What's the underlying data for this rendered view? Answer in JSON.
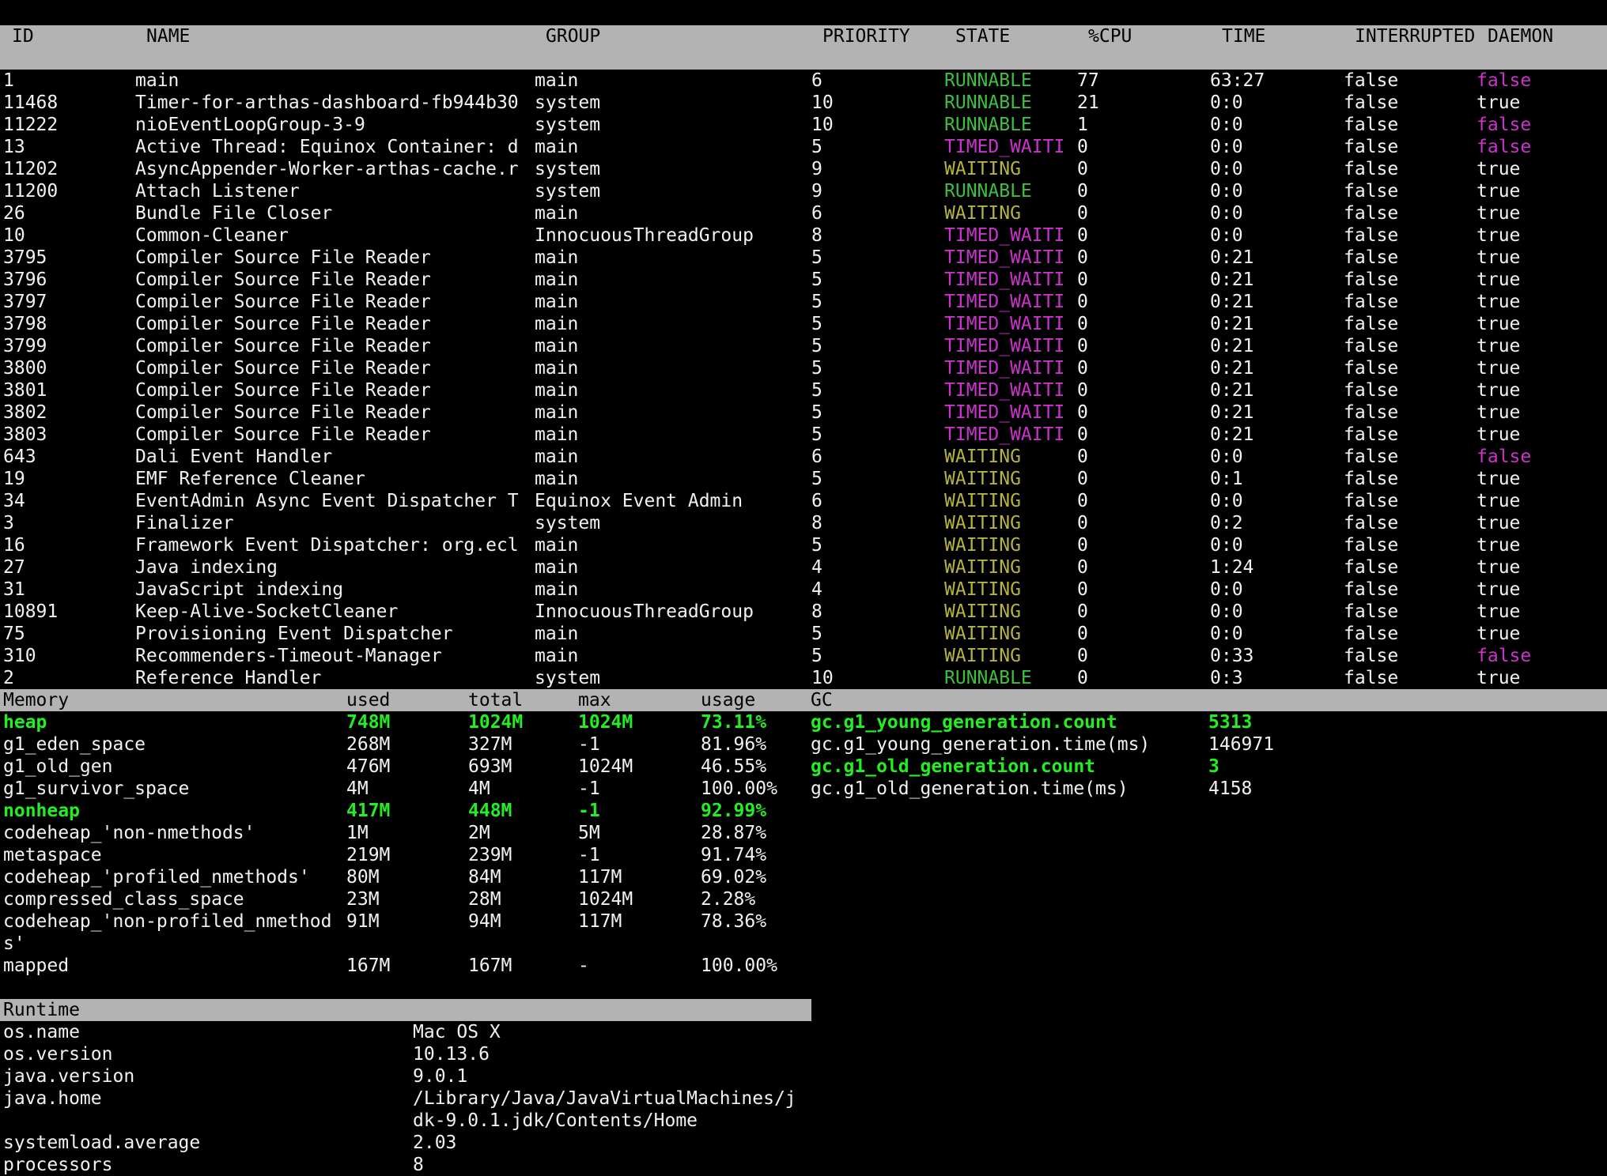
{
  "colors": {
    "background": "#000000",
    "header_bg": "#b3b3b3",
    "text": "#f2f2f2",
    "runnable": "#3fbf3f",
    "waiting": "#b7b33f",
    "timed_waiting": "#cc33cc",
    "highlight": "#22ee22"
  },
  "threads": {
    "columns": [
      "ID",
      "NAME",
      "GROUP",
      "PRIORITY",
      "STATE",
      "%CPU",
      "TIME",
      "INTERRUPTED",
      "DAEMON"
    ],
    "rows": [
      {
        "id": "1",
        "name": "main",
        "group": "main",
        "priority": "6",
        "state": "RUNNABLE",
        "cpu": "77",
        "time": "63:27",
        "interrupted": "false",
        "daemon": "false"
      },
      {
        "id": "11468",
        "name": "Timer-for-arthas-dashboard-fb944b30",
        "group": "system",
        "priority": "10",
        "state": "RUNNABLE",
        "cpu": "21",
        "time": "0:0",
        "interrupted": "false",
        "daemon": "true"
      },
      {
        "id": "11222",
        "name": "nioEventLoopGroup-3-9",
        "group": "system",
        "priority": "10",
        "state": "RUNNABLE",
        "cpu": "1",
        "time": "0:0",
        "interrupted": "false",
        "daemon": "false"
      },
      {
        "id": "13",
        "name": "Active Thread: Equinox Container: d",
        "group": "main",
        "priority": "5",
        "state": "TIMED_WAITI",
        "cpu": "0",
        "time": "0:0",
        "interrupted": "false",
        "daemon": "false"
      },
      {
        "id": "11202",
        "name": "AsyncAppender-Worker-arthas-cache.r",
        "group": "system",
        "priority": "9",
        "state": "WAITING",
        "cpu": "0",
        "time": "0:0",
        "interrupted": "false",
        "daemon": "true"
      },
      {
        "id": "11200",
        "name": "Attach Listener",
        "group": "system",
        "priority": "9",
        "state": "RUNNABLE",
        "cpu": "0",
        "time": "0:0",
        "interrupted": "false",
        "daemon": "true"
      },
      {
        "id": "26",
        "name": "Bundle File Closer",
        "group": "main",
        "priority": "6",
        "state": "WAITING",
        "cpu": "0",
        "time": "0:0",
        "interrupted": "false",
        "daemon": "true"
      },
      {
        "id": "10",
        "name": "Common-Cleaner",
        "group": "InnocuousThreadGroup",
        "priority": "8",
        "state": "TIMED_WAITI",
        "cpu": "0",
        "time": "0:0",
        "interrupted": "false",
        "daemon": "true"
      },
      {
        "id": "3795",
        "name": "Compiler Source File Reader",
        "group": "main",
        "priority": "5",
        "state": "TIMED_WAITI",
        "cpu": "0",
        "time": "0:21",
        "interrupted": "false",
        "daemon": "true"
      },
      {
        "id": "3796",
        "name": "Compiler Source File Reader",
        "group": "main",
        "priority": "5",
        "state": "TIMED_WAITI",
        "cpu": "0",
        "time": "0:21",
        "interrupted": "false",
        "daemon": "true"
      },
      {
        "id": "3797",
        "name": "Compiler Source File Reader",
        "group": "main",
        "priority": "5",
        "state": "TIMED_WAITI",
        "cpu": "0",
        "time": "0:21",
        "interrupted": "false",
        "daemon": "true"
      },
      {
        "id": "3798",
        "name": "Compiler Source File Reader",
        "group": "main",
        "priority": "5",
        "state": "TIMED_WAITI",
        "cpu": "0",
        "time": "0:21",
        "interrupted": "false",
        "daemon": "true"
      },
      {
        "id": "3799",
        "name": "Compiler Source File Reader",
        "group": "main",
        "priority": "5",
        "state": "TIMED_WAITI",
        "cpu": "0",
        "time": "0:21",
        "interrupted": "false",
        "daemon": "true"
      },
      {
        "id": "3800",
        "name": "Compiler Source File Reader",
        "group": "main",
        "priority": "5",
        "state": "TIMED_WAITI",
        "cpu": "0",
        "time": "0:21",
        "interrupted": "false",
        "daemon": "true"
      },
      {
        "id": "3801",
        "name": "Compiler Source File Reader",
        "group": "main",
        "priority": "5",
        "state": "TIMED_WAITI",
        "cpu": "0",
        "time": "0:21",
        "interrupted": "false",
        "daemon": "true"
      },
      {
        "id": "3802",
        "name": "Compiler Source File Reader",
        "group": "main",
        "priority": "5",
        "state": "TIMED_WAITI",
        "cpu": "0",
        "time": "0:21",
        "interrupted": "false",
        "daemon": "true"
      },
      {
        "id": "3803",
        "name": "Compiler Source File Reader",
        "group": "main",
        "priority": "5",
        "state": "TIMED_WAITI",
        "cpu": "0",
        "time": "0:21",
        "interrupted": "false",
        "daemon": "true"
      },
      {
        "id": "643",
        "name": "Dali Event Handler",
        "group": "main",
        "priority": "6",
        "state": "WAITING",
        "cpu": "0",
        "time": "0:0",
        "interrupted": "false",
        "daemon": "false"
      },
      {
        "id": "19",
        "name": "EMF Reference Cleaner",
        "group": "main",
        "priority": "5",
        "state": "WAITING",
        "cpu": "0",
        "time": "0:1",
        "interrupted": "false",
        "daemon": "true"
      },
      {
        "id": "34",
        "name": "EventAdmin Async Event Dispatcher T",
        "group": "Equinox Event Admin",
        "priority": "6",
        "state": "WAITING",
        "cpu": "0",
        "time": "0:0",
        "interrupted": "false",
        "daemon": "true"
      },
      {
        "id": "3",
        "name": "Finalizer",
        "group": "system",
        "priority": "8",
        "state": "WAITING",
        "cpu": "0",
        "time": "0:2",
        "interrupted": "false",
        "daemon": "true"
      },
      {
        "id": "16",
        "name": "Framework Event Dispatcher: org.ecl",
        "group": "main",
        "priority": "5",
        "state": "WAITING",
        "cpu": "0",
        "time": "0:0",
        "interrupted": "false",
        "daemon": "true"
      },
      {
        "id": "27",
        "name": "Java indexing",
        "group": "main",
        "priority": "4",
        "state": "WAITING",
        "cpu": "0",
        "time": "1:24",
        "interrupted": "false",
        "daemon": "true"
      },
      {
        "id": "31",
        "name": "JavaScript indexing",
        "group": "main",
        "priority": "4",
        "state": "WAITING",
        "cpu": "0",
        "time": "0:0",
        "interrupted": "false",
        "daemon": "true"
      },
      {
        "id": "10891",
        "name": "Keep-Alive-SocketCleaner",
        "group": "InnocuousThreadGroup",
        "priority": "8",
        "state": "WAITING",
        "cpu": "0",
        "time": "0:0",
        "interrupted": "false",
        "daemon": "true"
      },
      {
        "id": "75",
        "name": "Provisioning Event Dispatcher",
        "group": "main",
        "priority": "5",
        "state": "WAITING",
        "cpu": "0",
        "time": "0:0",
        "interrupted": "false",
        "daemon": "true"
      },
      {
        "id": "310",
        "name": "Recommenders-Timeout-Manager",
        "group": "main",
        "priority": "5",
        "state": "WAITING",
        "cpu": "0",
        "time": "0:33",
        "interrupted": "false",
        "daemon": "false"
      },
      {
        "id": "2",
        "name": "Reference Handler",
        "group": "system",
        "priority": "10",
        "state": "RUNNABLE",
        "cpu": "0",
        "time": "0:3",
        "interrupted": "false",
        "daemon": "true"
      }
    ]
  },
  "memory": {
    "columns": [
      "Memory",
      "used",
      "total",
      "max",
      "usage"
    ],
    "rows": [
      {
        "name": "heap",
        "used": "748M",
        "total": "1024M",
        "max": "1024M",
        "usage": "73.11%",
        "highlight": true
      },
      {
        "name": "g1_eden_space",
        "used": "268M",
        "total": "327M",
        "max": "-1",
        "usage": "81.96%"
      },
      {
        "name": "g1_old_gen",
        "used": "476M",
        "total": "693M",
        "max": "1024M",
        "usage": "46.55%"
      },
      {
        "name": "g1_survivor_space",
        "used": "4M",
        "total": "4M",
        "max": "-1",
        "usage": "100.00%"
      },
      {
        "name": "nonheap",
        "used": "417M",
        "total": "448M",
        "max": "-1",
        "usage": "92.99%",
        "highlight": true
      },
      {
        "name": "codeheap_'non-nmethods'",
        "used": "1M",
        "total": "2M",
        "max": "5M",
        "usage": "28.87%"
      },
      {
        "name": "metaspace",
        "used": "219M",
        "total": "239M",
        "max": "-1",
        "usage": "91.74%"
      },
      {
        "name": "codeheap_'profiled_nmethods'",
        "used": "80M",
        "total": "84M",
        "max": "117M",
        "usage": "69.02%"
      },
      {
        "name": "compressed_class_space",
        "used": "23M",
        "total": "28M",
        "max": "1024M",
        "usage": "2.28%"
      },
      {
        "name": "codeheap_'non-profiled_nmethod",
        "name_wrap": "s'",
        "used": "91M",
        "total": "94M",
        "max": "117M",
        "usage": "78.36%"
      },
      {
        "name": "mapped",
        "used": "167M",
        "total": "167M",
        "max": "-",
        "usage": "100.00%"
      }
    ]
  },
  "gc": {
    "header": "GC",
    "rows": [
      {
        "name": "gc.g1_young_generation.count",
        "value": "5313",
        "highlight": true
      },
      {
        "name": "gc.g1_young_generation.time(ms)",
        "value": "146971"
      },
      {
        "name": "gc.g1_old_generation.count",
        "value": "3",
        "highlight": true
      },
      {
        "name": "gc.g1_old_generation.time(ms)",
        "value": "4158"
      }
    ]
  },
  "runtime": {
    "header": "Runtime",
    "rows": [
      {
        "name": "os.name",
        "value": "Mac OS X"
      },
      {
        "name": "os.version",
        "value": "10.13.6"
      },
      {
        "name": "java.version",
        "value": "9.0.1"
      },
      {
        "name": "java.home",
        "value": "/Library/Java/JavaVirtualMachines/j",
        "value_wrap": "dk-9.0.1.jdk/Contents/Home"
      },
      {
        "name": "systemload.average",
        "value": "2.03"
      },
      {
        "name": "processors",
        "value": "8"
      }
    ]
  }
}
